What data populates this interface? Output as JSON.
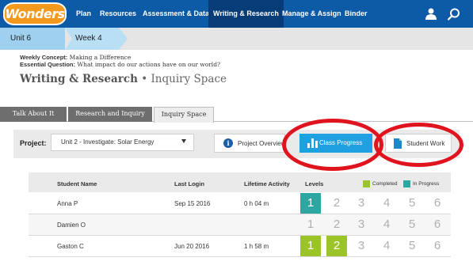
{
  "nav": {
    "logo": "Wonders",
    "items": [
      "Plan",
      "Resources",
      "Assessment & Data",
      "Writing & Research",
      "Manage & Assign",
      "Binder"
    ],
    "active_index": 3,
    "icons": {
      "user": "user-icon",
      "search": "search-icon"
    }
  },
  "breadcrumb": {
    "unit": "Unit 6",
    "week": "Week 4"
  },
  "concept": {
    "weekly_label": "Weekly Concept:",
    "weekly_value": " Making a Difference",
    "question_label": "Essential Question:",
    "question_value": " What impact do our actions have on our world?"
  },
  "page": {
    "title": "Writing & Research",
    "separator": " • ",
    "subtitle": "Inquiry Space"
  },
  "tabs": [
    "Talk About It",
    "Research and Inquiry",
    "Inquiry Space"
  ],
  "active_tab": 2,
  "project": {
    "label": "Project:",
    "selected": "Unit 2 - Investigate: Solar Energy"
  },
  "buttons": {
    "overview": "Project Overview",
    "progress": "Class Progress",
    "student_work": "Student Work"
  },
  "table": {
    "headers": {
      "name": "Student Name",
      "login": "Last Login",
      "activity": "Lifetime Activity",
      "levels": "Levels"
    },
    "legend": {
      "completed": "Completed",
      "in_progress": "In Progress"
    },
    "level_numbers": [
      "1",
      "2",
      "3",
      "4",
      "5",
      "6"
    ],
    "rows": [
      {
        "name": "Anna P",
        "login": "Sep 15 2016",
        "activity": "0 h 04 m",
        "completed_levels": 0,
        "in_progress_level": 1
      },
      {
        "name": "Damien O",
        "login": "",
        "activity": "",
        "completed_levels": 0,
        "in_progress_level": 0
      },
      {
        "name": "Gaston C",
        "login": "Jun 20 2016",
        "activity": "1 h 58 m",
        "completed_levels": 2,
        "in_progress_level": 0
      }
    ]
  },
  "colors": {
    "nav_bg": "#0d5aa7",
    "completed": "#9bc429",
    "in_progress": "#2ea7a3",
    "progress_button": "#1fa0e0",
    "annotation": "#e0141e"
  }
}
